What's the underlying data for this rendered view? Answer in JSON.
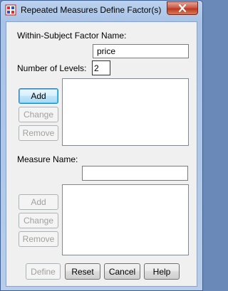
{
  "window": {
    "title": "Repeated Measures Define Factor(s)"
  },
  "factor": {
    "name_label": "Within-Subject Factor Name:",
    "name_value": "price",
    "levels_label": "Number of Levels:",
    "levels_value": "2"
  },
  "factor_buttons": {
    "add": "Add",
    "change": "Change",
    "remove": "Remove"
  },
  "measure": {
    "name_label": "Measure Name:",
    "name_value": ""
  },
  "measure_buttons": {
    "add": "Add",
    "change": "Change",
    "remove": "Remove"
  },
  "footer": {
    "define": "Define",
    "reset": "Reset",
    "cancel": "Cancel",
    "help": "Help"
  },
  "colors": {
    "title_bar": "#b7cdea",
    "close_button": "#c8452e",
    "dialog_bg": "#f0f0f0"
  }
}
